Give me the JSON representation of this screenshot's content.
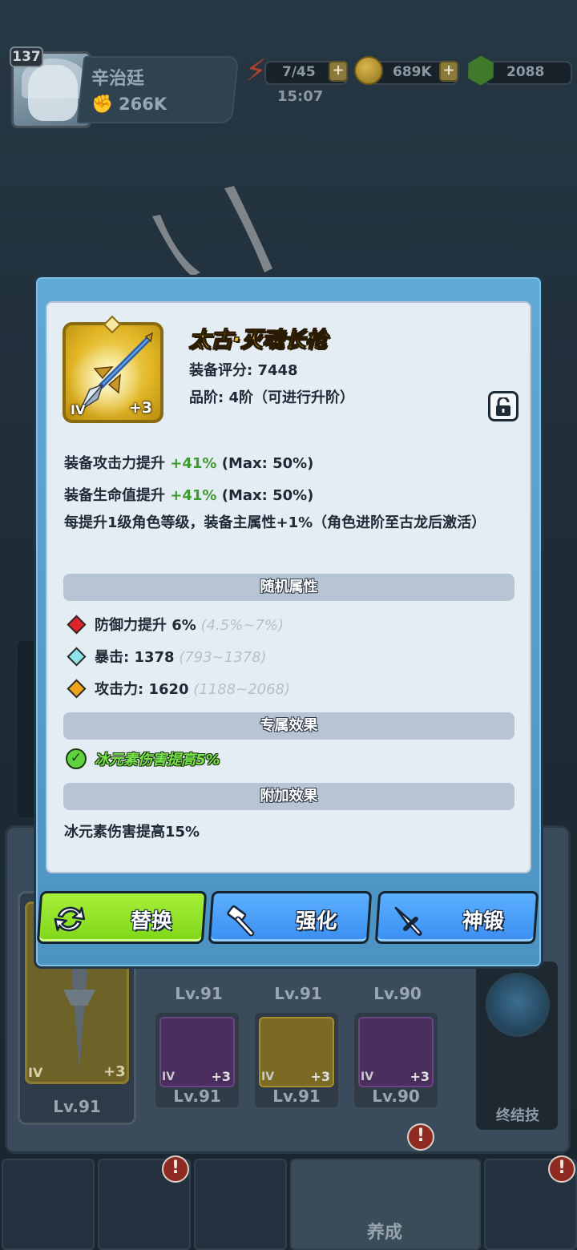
{
  "player": {
    "level": "137",
    "name": "辛治廷",
    "power": "266K"
  },
  "resources": {
    "energy": "7/45",
    "energy_timer": "15:07",
    "gold": "689K",
    "gems": "2088",
    "plus": "+"
  },
  "background": {
    "slots": [
      {
        "level": "Lv.91"
      },
      {
        "level": "Lv.91"
      },
      {
        "level": "Lv.91"
      },
      {
        "level": "Lv.90"
      },
      {
        "level": "Lv.91",
        "tier": "IV",
        "plus": "+3"
      },
      {
        "level": "Lv.91",
        "tier": "IV",
        "plus": "+3"
      },
      {
        "level": "Lv.91",
        "tier": "IV",
        "plus": "+3"
      },
      {
        "level": "Lv.90",
        "tier": "IV",
        "plus": "+3"
      }
    ],
    "main_slot": {
      "level": "Lv.91",
      "tier": "IV",
      "plus": "+3"
    },
    "ultimate_label": "终结技",
    "nav_active_label": "养成",
    "alert": "!"
  },
  "item": {
    "name": "太古·灭魂长枪",
    "score": "装备评分: 7448",
    "grade": "品阶: 4阶（可进行升阶）",
    "tier": "IV",
    "plus": "+3",
    "icon": "spear-icon",
    "frame_color": "#e2b625"
  },
  "stats": {
    "attack_prefix": "装备攻击力提升 ",
    "attack_pct": "+41%",
    "attack_max": " (Max: 50%)",
    "hp_prefix": "装备生命值提升 ",
    "hp_pct": "+41%",
    "hp_max": " (Max: 50%)",
    "level_bonus": "每提升1级角色等级，装备主属性+1%（角色进阶至古龙后激活）"
  },
  "random_attrs": {
    "header": "随机属性",
    "rows": [
      {
        "label": "防御力提升 6%",
        "range": " (4.5%~7%)",
        "color": "#e0242a"
      },
      {
        "label": "暴击: 1378",
        "range": " (793~1378)",
        "color": "#8fe3ea"
      },
      {
        "label": "攻击力: 1620",
        "range": " (1188~2068)",
        "color": "#f0a31c"
      }
    ]
  },
  "exclusive": {
    "header": "专属效果",
    "text": "冰元素伤害提高5%"
  },
  "extra": {
    "header": "附加效果",
    "text": "冰元素伤害提高15%"
  },
  "buttons": {
    "replace": "替换",
    "enhance": "强化",
    "forge": "神锻"
  }
}
